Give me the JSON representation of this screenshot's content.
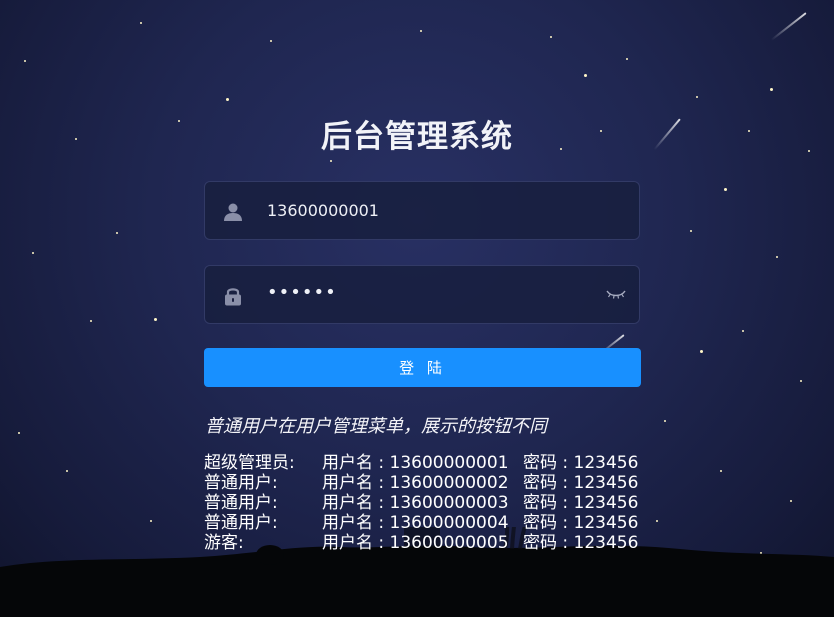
{
  "page": {
    "title": "后台管理系统"
  },
  "login_form": {
    "username_value": "13600000001",
    "password_mask": "••••••",
    "login_button_label": "登 陆"
  },
  "hint_text": "普通用户在用户管理菜单，展示的按钮不同",
  "accounts": [
    {
      "role": "超级管理员:",
      "username": "用户名 : 13600000001",
      "password": "密码 : 123456"
    },
    {
      "role": "普通用户:",
      "username": "用户名 : 13600000002",
      "password": "密码 : 123456"
    },
    {
      "role": "普通用户:",
      "username": "用户名 : 13600000003",
      "password": "密码 : 123456"
    },
    {
      "role": "普通用户:",
      "username": "用户名 : 13600000004",
      "password": "密码 : 123456"
    },
    {
      "role": "游客:",
      "username": "用户名 : 13600000005",
      "password": "密码 : 123456"
    }
  ],
  "icons": {
    "username": "user-icon",
    "password": "lock-icon",
    "toggle": "eye-closed-icon"
  },
  "colors": {
    "primary_button": "#1890ff",
    "background": "#1f2650",
    "field_border": "#323a66"
  }
}
